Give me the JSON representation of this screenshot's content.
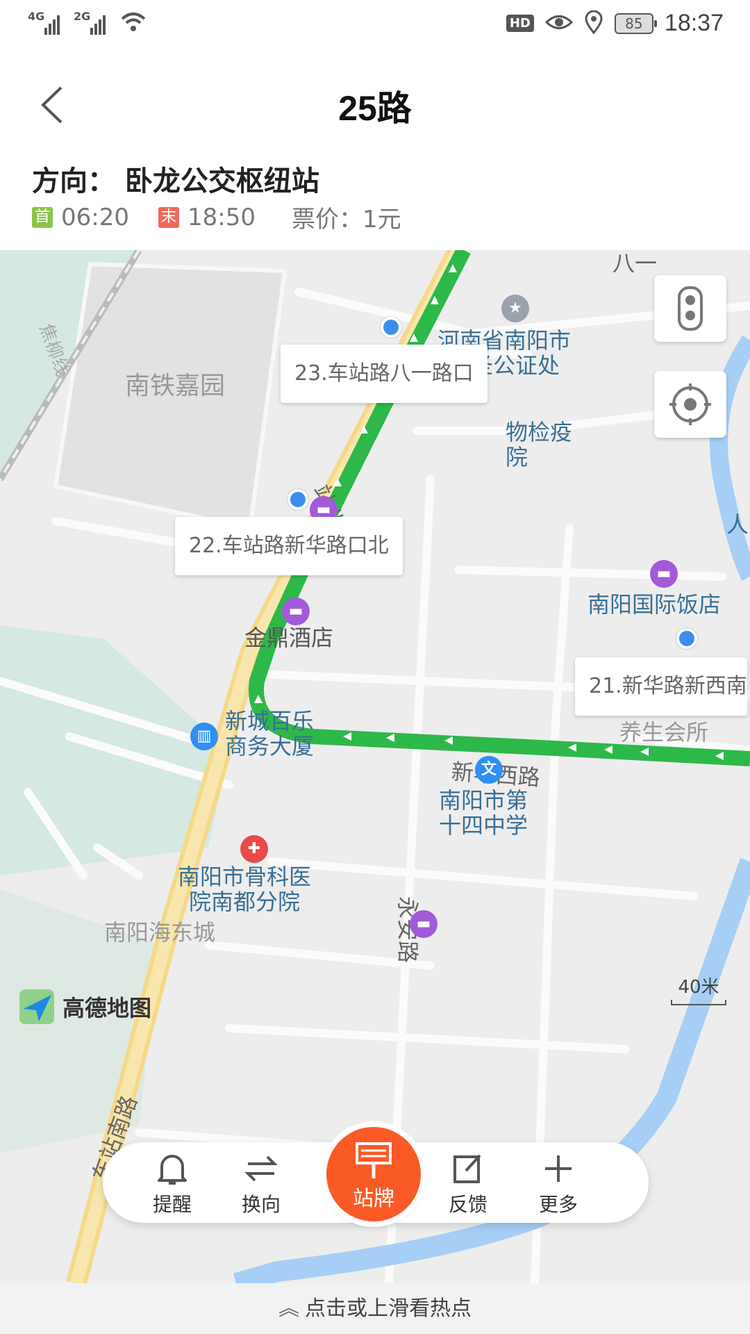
{
  "status": {
    "net1": "4G",
    "net2": "2G",
    "hd": "HD",
    "battery": "85",
    "time": "18:37"
  },
  "header": {
    "title": "25路"
  },
  "route": {
    "direction": "方向： 卧龙公交枢纽站",
    "first_tag": "首",
    "first_time": "06:20",
    "last_tag": "末",
    "last_time": "18:50",
    "fare": "票价：1元"
  },
  "map": {
    "stops": [
      {
        "label": "23.车站路八一路口"
      },
      {
        "label": "22.车站路新华路口北"
      },
      {
        "label": "21.新华路新西南"
      }
    ],
    "pois": {
      "notary": "河南省南阳市\n智圣公证处",
      "quarantine": "物检疫\n院",
      "residence": "南铁嘉园",
      "jinding": "金鼎酒店",
      "intl_hotel": "南阳国际饭店",
      "spa": "养生会所",
      "xincheng": "新城百乐\n商务大厦",
      "school": "南阳市第\n十四中学",
      "hospital": "南阳市骨科医\n院南都分院",
      "bottom_partial": "南阳海东城"
    },
    "streets": {
      "bayi": "八一",
      "zhanbei": "站北路",
      "xinhua": "新华西路",
      "yongan": "永安路",
      "zhannan": "车站南路",
      "jiaoliu": "焦柳线",
      "ren": "人"
    },
    "scale": "40米",
    "brand": "高德地图"
  },
  "actions": {
    "remind": "提醒",
    "switch": "换向",
    "board": "站牌",
    "feedback": "反馈",
    "more": "更多"
  },
  "bottom_hint": "点击或上滑看热点",
  "colors": {
    "route": "#2db84a",
    "accent": "#fa5a26",
    "stop": "#3b8ef0"
  }
}
